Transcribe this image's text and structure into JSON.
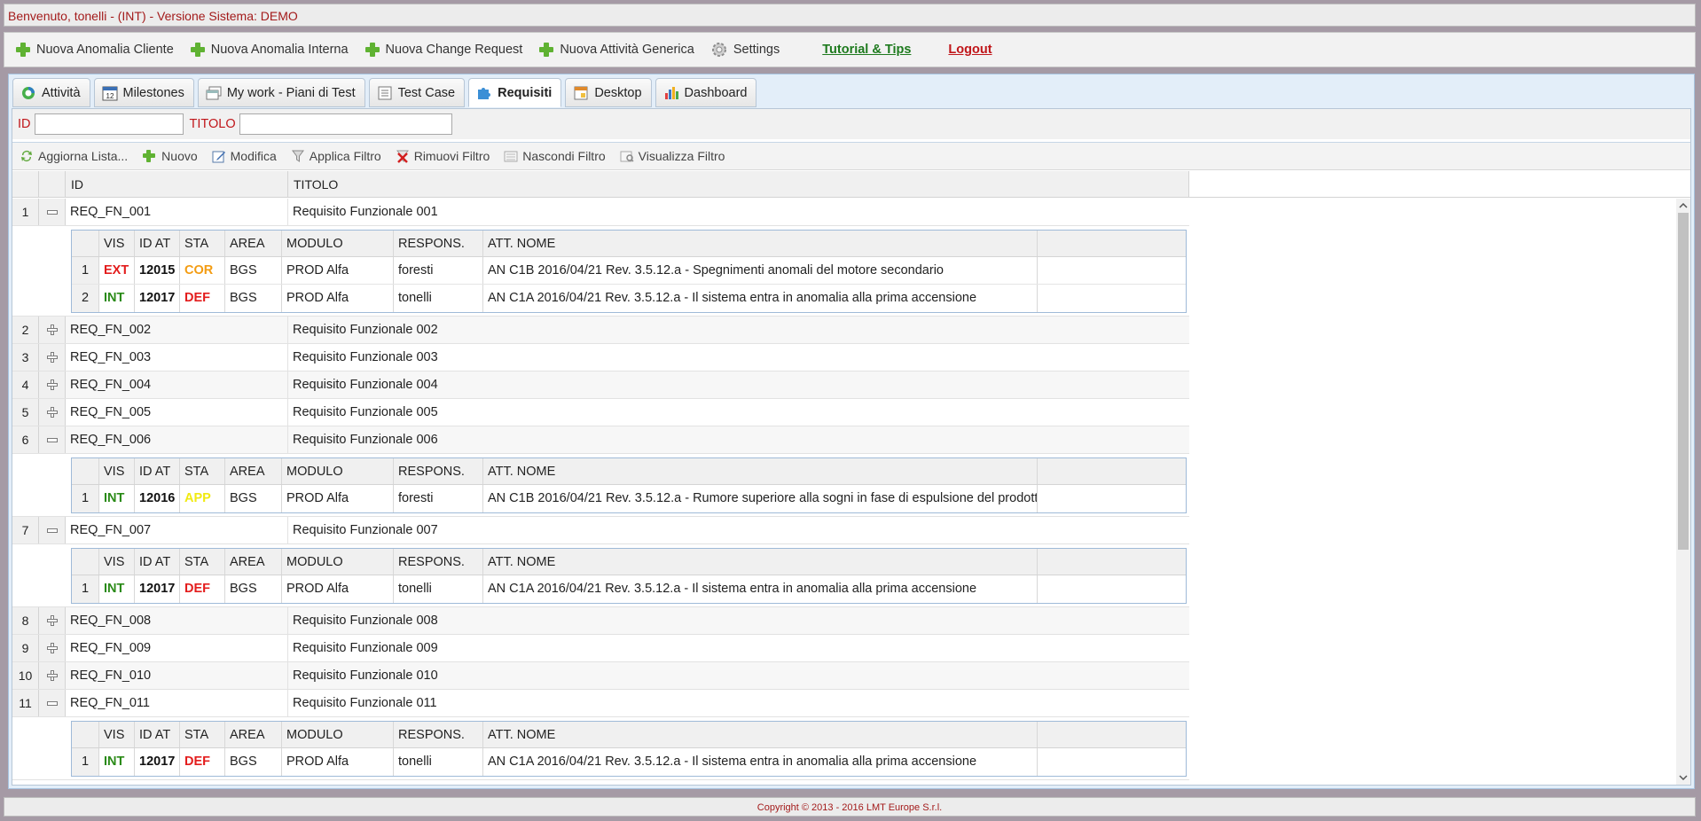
{
  "header": {
    "welcome": "Benvenuto, tonelli - (INT) - Versione Sistema: DEMO"
  },
  "menu": {
    "items": [
      "Nuova Anomalia Cliente",
      "Nuova Anomalia Interna",
      "Nuova Change Request",
      "Nuova Attività Generica"
    ],
    "settings": "Settings",
    "tutorial": "Tutorial & Tips",
    "logout": "Logout"
  },
  "tabs": [
    "Attività",
    "Milestones",
    "My work - Piani di Test",
    "Test Case",
    "Requisiti",
    "Desktop",
    "Dashboard"
  ],
  "active_tab": "Requisiti",
  "filter": {
    "id_label": "ID",
    "title_label": "TITOLO",
    "id_value": "",
    "title_value": ""
  },
  "toolbar": {
    "refresh": "Aggiorna Lista...",
    "new": "Nuovo",
    "edit": "Modifica",
    "apply_filter": "Applica Filtro",
    "remove_filter": "Rimuovi Filtro",
    "hide_filter": "Nascondi Filtro",
    "show_filter": "Visualizza Filtro"
  },
  "grid": {
    "columns": [
      "ID",
      "TITOLO"
    ],
    "sub_columns": [
      "VIS",
      "ID AT",
      "STA",
      "AREA",
      "MODULO",
      "RESPONS.",
      "ATT. NOME"
    ],
    "rows": [
      {
        "n": "1",
        "id": "REQ_FN_001",
        "title": "Requisito Funzionale 001"
      },
      {
        "n": "",
        "id": "",
        "title": ""
      },
      {
        "n": "2",
        "id": "REQ_FN_002",
        "title": "Requisito Funzionale 002"
      },
      {
        "n": "3",
        "id": "REQ_FN_003",
        "title": "Requisito Funzionale 003"
      },
      {
        "n": "4",
        "id": "REQ_FN_004",
        "title": "Requisito Funzionale 004"
      },
      {
        "n": "5",
        "id": "REQ_FN_005",
        "title": "Requisito Funzionale 005"
      },
      {
        "n": "6",
        "id": "REQ_FN_006",
        "title": "Requisito Funzionale 006"
      },
      {
        "n": "7",
        "id": "REQ_FN_007",
        "title": "Requisito Funzionale 007"
      },
      {
        "n": "8",
        "id": "REQ_FN_008",
        "title": "Requisito Funzionale 008"
      },
      {
        "n": "9",
        "id": "REQ_FN_009",
        "title": "Requisito Funzionale 009"
      },
      {
        "n": "10",
        "id": "REQ_FN_010",
        "title": "Requisito Funzionale 010"
      },
      {
        "n": "11",
        "id": "REQ_FN_011",
        "title": "Requisito Funzionale 011"
      }
    ],
    "sub_rows": {
      "r1": [
        {
          "n": "1",
          "vis": "EXT",
          "id_at": "12015",
          "sta": "COR",
          "area": "BGS",
          "modulo": "PROD Alfa",
          "resp": "foresti",
          "nome": "AN C1B 2016/04/21 Rev. 3.5.12.a - Spegnimenti anomali del motore secondario"
        },
        {
          "n": "2",
          "vis": "INT",
          "id_at": "12017",
          "sta": "DEF",
          "area": "BGS",
          "modulo": "PROD Alfa",
          "resp": "tonelli",
          "nome": "AN C1A 2016/04/21 Rev. 3.5.12.a - Il sistema entra in anomalia alla prima accensione"
        }
      ],
      "r6": [
        {
          "n": "1",
          "vis": "INT",
          "id_at": "12016",
          "sta": "APP",
          "area": "BGS",
          "modulo": "PROD Alfa",
          "resp": "foresti",
          "nome": "AN C1B 2016/04/21 Rev. 3.5.12.a - Rumore superiore alla sogni in fase di espulsione del prodott"
        }
      ],
      "r7": [
        {
          "n": "1",
          "vis": "INT",
          "id_at": "12017",
          "sta": "DEF",
          "area": "BGS",
          "modulo": "PROD Alfa",
          "resp": "tonelli",
          "nome": "AN C1A 2016/04/21 Rev. 3.5.12.a - Il sistema entra in anomalia alla prima accensione"
        }
      ],
      "r11": [
        {
          "n": "1",
          "vis": "INT",
          "id_at": "12017",
          "sta": "DEF",
          "area": "BGS",
          "modulo": "PROD Alfa",
          "resp": "tonelli",
          "nome": "AN C1A 2016/04/21 Rev. 3.5.12.a - Il sistema entra in anomalia alla prima accensione"
        }
      ]
    }
  },
  "colors": {
    "EXT": "#e31d1d",
    "INT": "#2a8a17",
    "COR": "#f39c12",
    "DEF": "#e31d1d",
    "APP": "#f1ea12"
  },
  "footer": {
    "copyright": "Copyright © 2013 - 2016 LMT Europe S.r.l."
  }
}
